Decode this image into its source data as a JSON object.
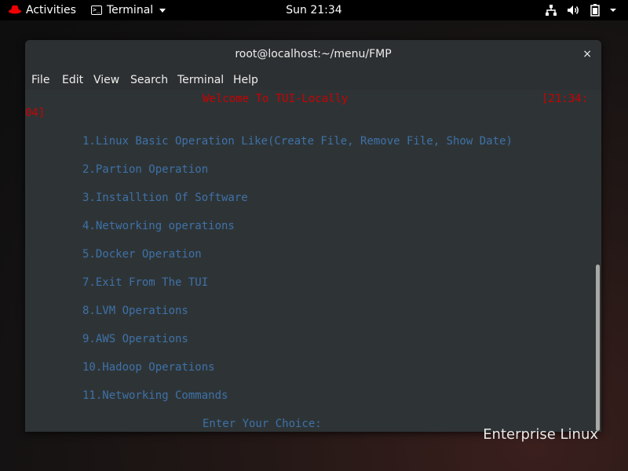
{
  "topbar": {
    "activities": "Activities",
    "app_name": "Terminal",
    "clock": "Sun 21:34"
  },
  "window": {
    "title": "root@localhost:~/menu/FMP",
    "close": "×",
    "menu": [
      "File",
      "Edit",
      "View",
      "Search",
      "Terminal",
      "Help"
    ]
  },
  "terminal": {
    "welcome": "Welcome To TUI-Locally",
    "time_part1": "[21:34:",
    "time_part2": "04]",
    "options": [
      "1.Linux Basic Operation Like(Create File, Remove File, Show Date)",
      "2.Partion Operation",
      "3.Installtion Of Software",
      "4.Networking operations",
      "5.Docker Operation",
      "7.Exit From The TUI",
      "8.LVM Operations",
      "9.AWS Operations",
      "10.Hadoop Operations",
      "11.Networking Commands"
    ],
    "prompt": "Enter Your Choice:"
  },
  "desktop": {
    "watermark": "Enterprise Linux"
  },
  "colors": {
    "terminal_bg": "#2e3436",
    "menu_text": "#3f71a8",
    "header_text": "#cc0000"
  },
  "icons": [
    "redhat-logo-icon",
    "terminal-icon",
    "chevron-down-icon",
    "network-icon",
    "volume-icon",
    "battery-icon",
    "power-menu-icon",
    "close-icon"
  ]
}
